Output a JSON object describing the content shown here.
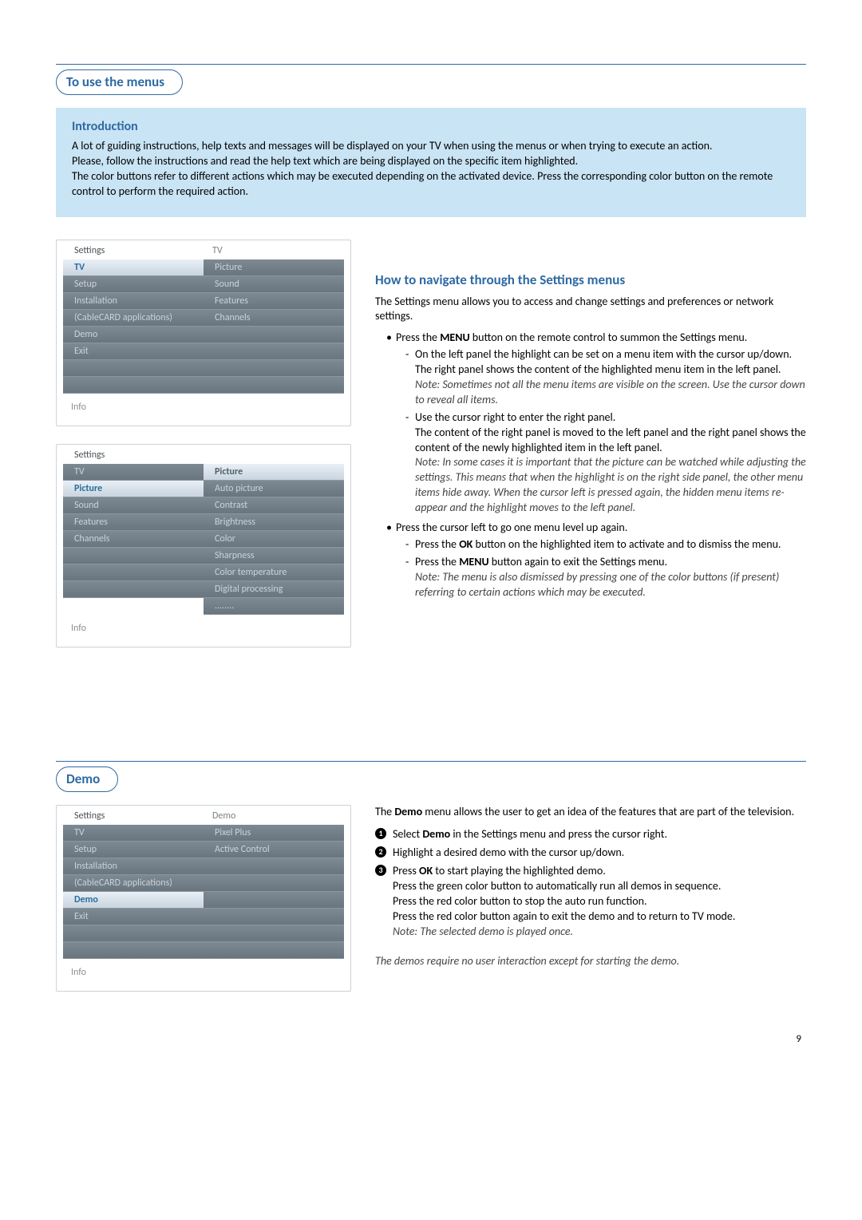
{
  "page_number": "9",
  "section1": {
    "pill": "To use the menus",
    "intro_heading": "Introduction",
    "intro_p1": "A lot of guiding instructions, help texts and messages will be displayed on your TV when using the menus or when trying to execute an action.",
    "intro_p2": "Please, follow the instructions and read the help text which are being displayed on the specific item highlighted.",
    "intro_p3": "The color buttons refer to different actions which may be executed depending on the activated device. Press the corresponding color button on the remote control to perform the required action."
  },
  "panel1": {
    "header_left": "Settings",
    "header_right": "TV",
    "left_items": [
      "TV",
      "Setup",
      "Installation",
      "(CableCARD applications)",
      "Demo",
      "Exit",
      "",
      ""
    ],
    "left_highlight_index": 0,
    "right_title": null,
    "right_items": [
      "Picture",
      "Sound",
      "Features",
      "Channels",
      "",
      "",
      "",
      ""
    ],
    "info": "Info"
  },
  "panel2": {
    "header_left": "Settings",
    "header_right": "",
    "left_items": [
      "TV",
      "Picture",
      "Sound",
      "Features",
      "Channels",
      "",
      "",
      ""
    ],
    "left_highlight_index": 1,
    "right_title": "Picture",
    "right_title_pos": 0,
    "right_items": [
      "Picture",
      "Auto picture",
      "Contrast",
      "Brightness",
      "Color",
      "Sharpness",
      "Color temperature",
      "Digital processing",
      "........"
    ],
    "info": "Info"
  },
  "howto": {
    "heading": "How to navigate through the Settings menus",
    "lead": "The Settings menu allows you to access and change settings and preferences or network settings.",
    "b1_pre": "Press the ",
    "b1_bold": "MENU",
    "b1_post": " button on the remote control to summon the Settings menu.",
    "b1_d1": "On the left panel the highlight can be set on a menu item with the cursor up/down.",
    "b1_d1b": "The right panel shows the content of the highlighted menu item in the left panel.",
    "b1_note": "Note: Sometimes not all the menu items are visible on the screen. Use the cursor down to reveal all items.",
    "b1_d2": "Use the cursor right to enter the right panel.",
    "b1_d2b": "The content of the right panel is moved to the left panel and the right panel shows the content of the newly highlighted item in the left panel.",
    "b1_note2": "Note: In some cases it is important that the picture can be watched while adjusting the settings. This means that when the highlight is on the right side panel, the other menu items hide away.  When the cursor left is pressed again, the hidden menu items re-appear and the highlight moves to the left panel.",
    "b2": "Press the cursor left to go one menu level up again.",
    "b2_d1_pre": "Press the ",
    "b2_d1_bold": "OK",
    "b2_d1_post": " button on the highlighted item to activate and to dismiss the menu.",
    "b2_d2_pre": "Press the ",
    "b2_d2_bold": "MENU",
    "b2_d2_post": " button again to exit the Settings menu.",
    "b2_note": "Note: The menu is also dismissed by pressing one of the color buttons (if present) referring to certain actions which may be executed."
  },
  "section2": {
    "pill": "Demo"
  },
  "panel3": {
    "header_left": "Settings",
    "header_right": "Demo",
    "left_items": [
      "TV",
      "Setup",
      "Installation",
      "(CableCARD applications)",
      "Demo",
      "Exit",
      "",
      ""
    ],
    "left_highlight_index": 4,
    "right_items": [
      "Pixel Plus",
      "Active Control",
      "",
      "",
      "",
      "",
      "",
      ""
    ],
    "info": "Info"
  },
  "demo": {
    "lead_pre": "The ",
    "lead_bold": "Demo",
    "lead_post": " menu allows the user to get an idea of the features that are part of the television.",
    "s1_pre": "Select ",
    "s1_bold": "Demo",
    "s1_post": " in the Settings menu and press the cursor right.",
    "s2": "Highlight a desired demo with the cursor up/down.",
    "s3_pre": "Press ",
    "s3_bold": "OK",
    "s3_post": " to start playing the highlighted demo.",
    "s3b": "Press the green color button to automatically run all demos in sequence.",
    "s3c": "Press the red color button to stop the auto run function.",
    "s3d": "Press the red color button again to exit the demo and to return to TV mode.",
    "s3_note": "Note: The selected demo is played once.",
    "footer_note": "The demos require no user interaction except for starting the demo."
  }
}
